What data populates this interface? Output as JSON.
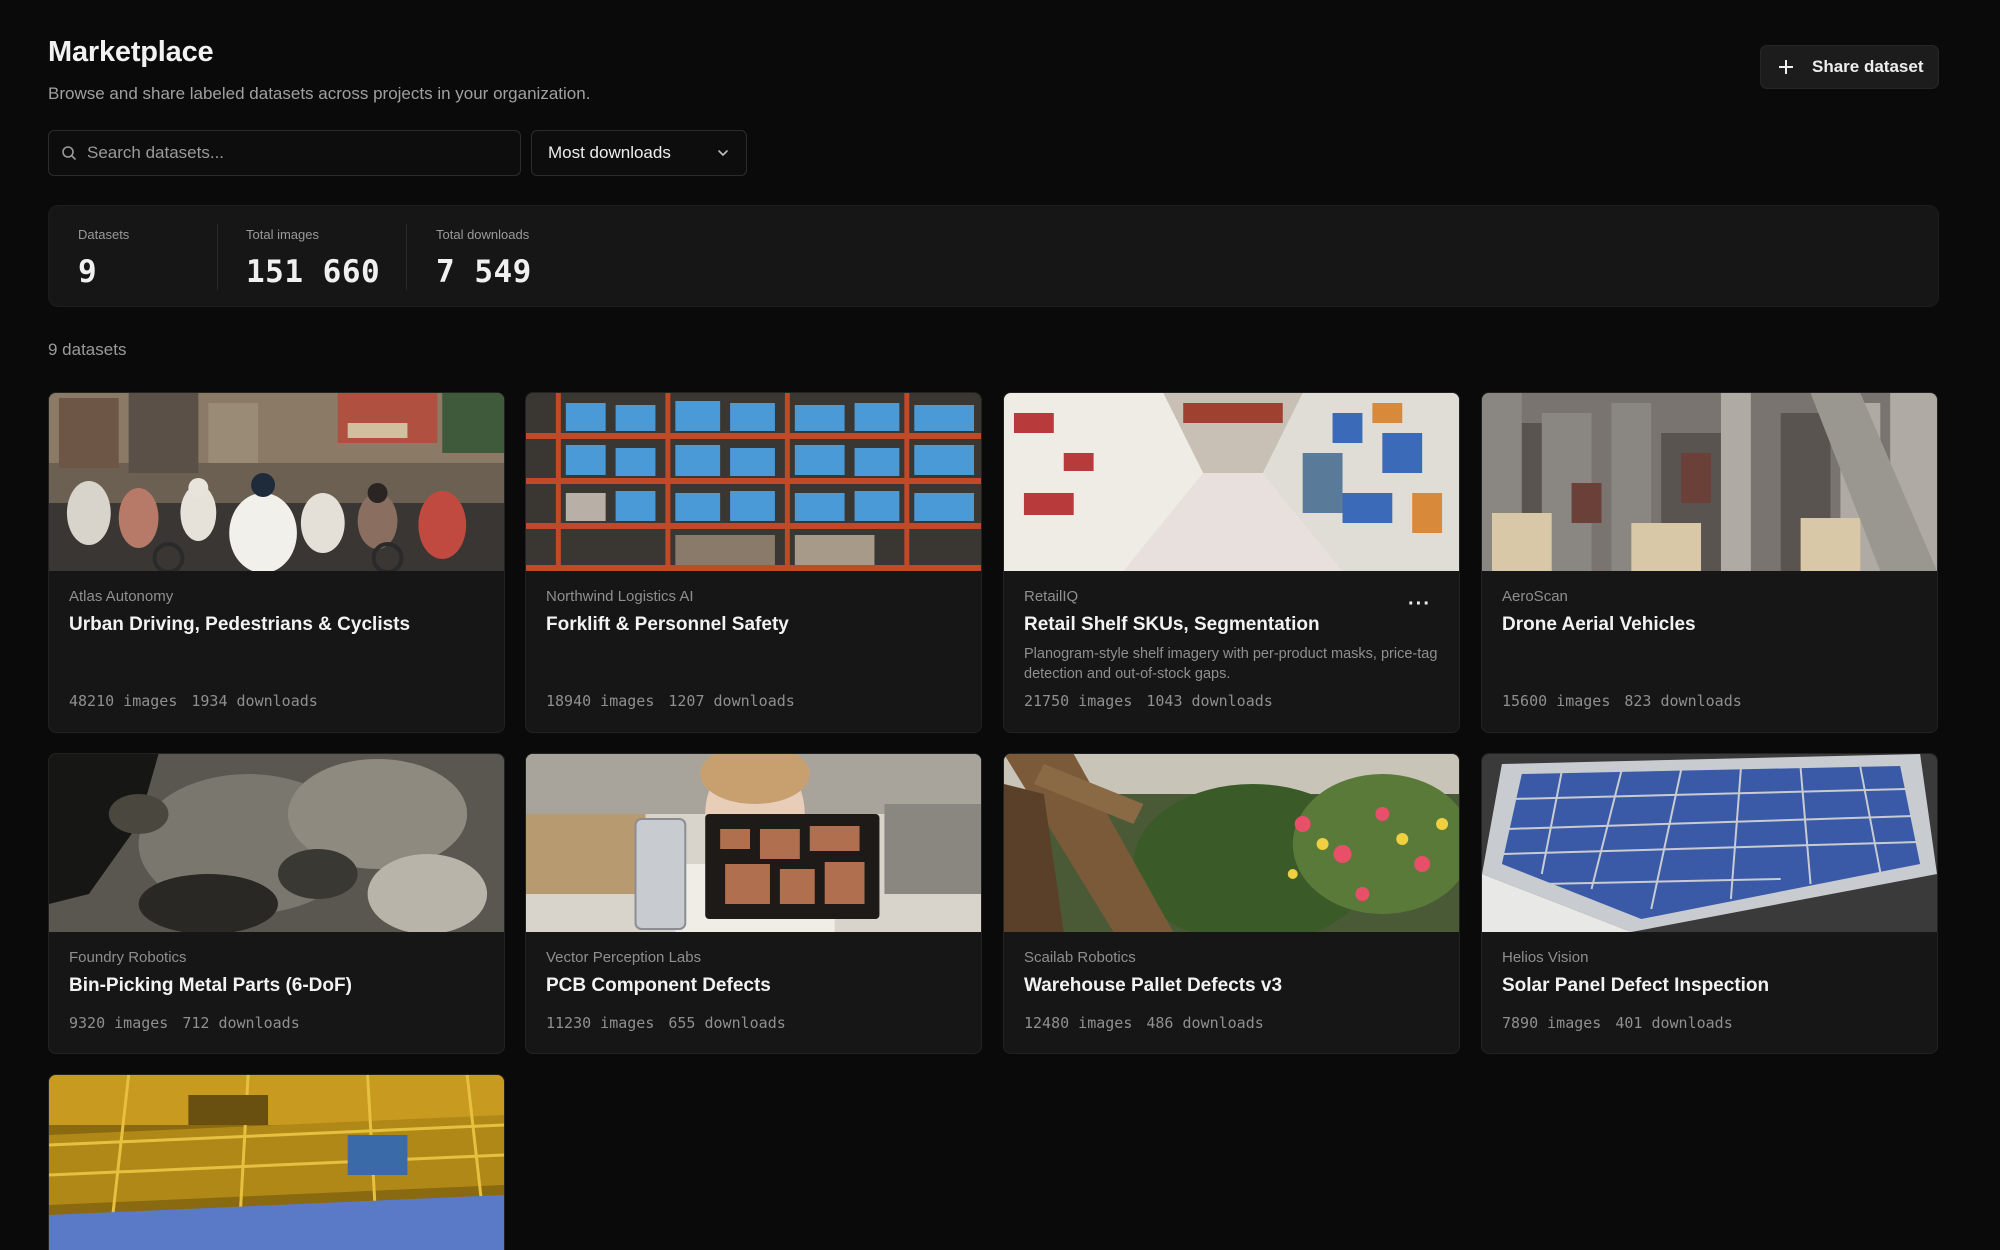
{
  "header": {
    "title": "Marketplace",
    "subtitle": "Browse and share labeled datasets across projects in your organization.",
    "share_label": "Share dataset"
  },
  "search": {
    "placeholder": "Search datasets..."
  },
  "sort": {
    "selected": "Most downloads"
  },
  "stats": [
    {
      "label": "Datasets",
      "value": "9"
    },
    {
      "label": "Total images",
      "value": "151 660"
    },
    {
      "label": "Total downloads",
      "value": "7 549"
    }
  ],
  "count_label": "9 datasets",
  "datasets": [
    {
      "org": "Atlas Autonomy",
      "title": "Urban Driving, Pedestrians & Cyclists",
      "images": "48210 images",
      "downloads": "1934 downloads"
    },
    {
      "org": "Northwind Logistics AI",
      "title": "Forklift & Personnel Safety",
      "images": "18940 images",
      "downloads": "1207 downloads"
    },
    {
      "org": "RetailIQ",
      "title": "Retail Shelf SKUs, Segmentation",
      "description": "Planogram-style shelf imagery with per-product masks, price-tag detection and out-of-stock gaps.",
      "images": "21750 images",
      "downloads": "1043 downloads",
      "menu": "···"
    },
    {
      "org": "AeroScan",
      "title": "Drone Aerial Vehicles",
      "images": "15600 images",
      "downloads": "823 downloads"
    },
    {
      "org": "Foundry Robotics",
      "title": "Bin-Picking Metal Parts (6-DoF)",
      "images": "9320 images",
      "downloads": "712 downloads"
    },
    {
      "org": "Vector Perception Labs",
      "title": "PCB Component Defects",
      "images": "11230 images",
      "downloads": "655 downloads"
    },
    {
      "org": "Scailab Robotics",
      "title": "Warehouse Pallet Defects v3",
      "images": "12480 images",
      "downloads": "486 downloads"
    },
    {
      "org": "Helios Vision",
      "title": "Solar Panel Defect Inspection",
      "images": "7890 images",
      "downloads": "401 downloads"
    },
    {
      "org": "",
      "title": "",
      "images": "",
      "downloads": ""
    }
  ]
}
